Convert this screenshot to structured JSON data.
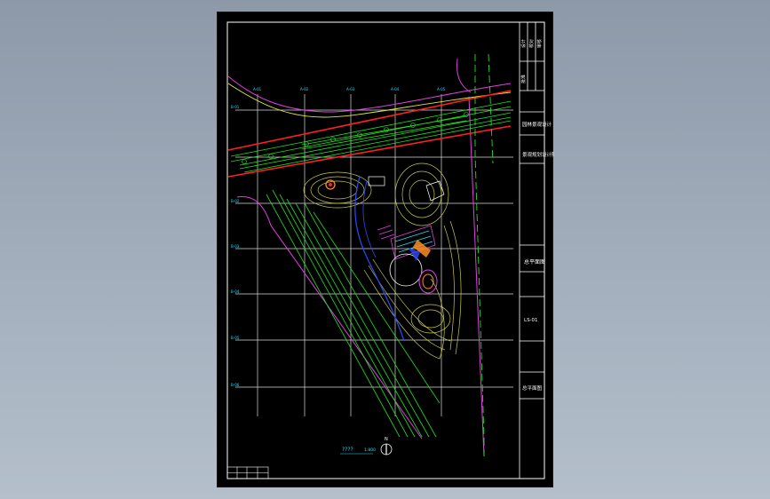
{
  "drawing": {
    "view_title": "????",
    "view_scale": "1:800",
    "north_label": "N"
  },
  "grid": {
    "top_labels": [
      "A-01",
      "A-02",
      "A-03",
      "A-04",
      "A-05"
    ],
    "left_labels": [
      "B-01",
      "B-02",
      "B-03",
      "B-04",
      "B-05",
      "B-06"
    ]
  },
  "title_block": {
    "header_cells": [
      "设计",
      "校对",
      "审核",
      "批准"
    ],
    "project_name": "园林景观设计",
    "drawing_name": "总平面图",
    "drawing_number": "LS-01",
    "company": "景观规划设计院"
  },
  "colors": {
    "background": "#000000",
    "frame": "#ffffff",
    "grid": "#ffffff",
    "road_red": "#ff2020",
    "road_yellow": "#e6e640",
    "green": "#20e020",
    "contour": "#c8c84a",
    "water_blue": "#2a4cff",
    "magenta": "#e040e0",
    "cyan": "#20e0ff",
    "orange": "#ff8c20"
  }
}
